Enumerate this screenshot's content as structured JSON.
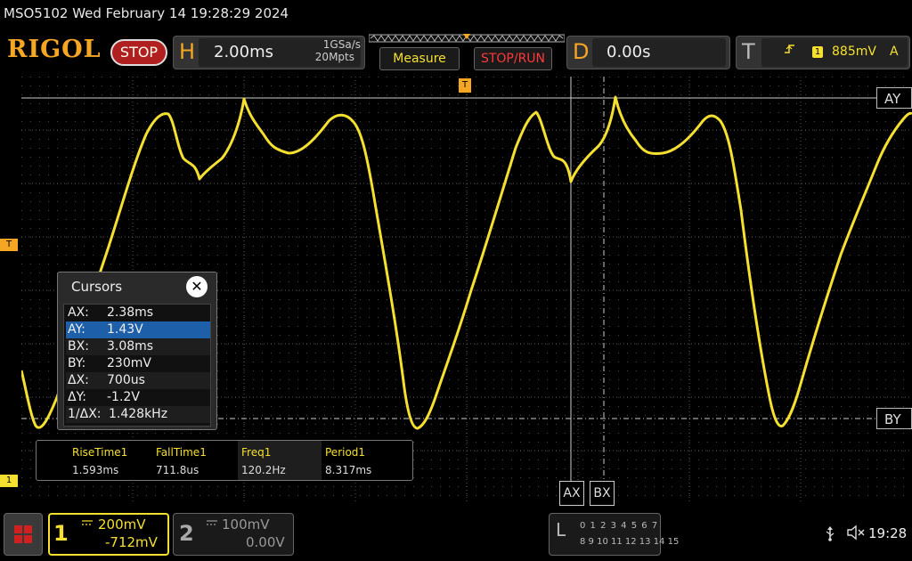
{
  "topbar": {
    "model_datetime": "MSO5102  Wed February 14 19:28:29 2024",
    "brand": "RIGOL",
    "run_state": "STOP",
    "horizontal": {
      "letter": "H",
      "timebase": "2.00ms",
      "sample_rate": "1GSa/s",
      "memory_depth": "20Mpts"
    },
    "measure_label": "Measure",
    "stoprun_label": "STOP/RUN",
    "delay": {
      "letter": "D",
      "value": "0.00s"
    },
    "trigger": {
      "letter": "T",
      "source": "1",
      "level": "885mV",
      "mode": "A"
    }
  },
  "markers": {
    "ay": "AY",
    "by": "BY",
    "ax": "AX",
    "bx": "BX",
    "trigger_level": "T",
    "trigger_top": "T",
    "ch1": "1"
  },
  "cursors": {
    "title": "Cursors",
    "close": "✕",
    "rows": [
      {
        "label": "AX:",
        "value": "2.38ms"
      },
      {
        "label": "AY:",
        "value": "1.43V"
      },
      {
        "label": "BX:",
        "value": "3.08ms"
      },
      {
        "label": "BY:",
        "value": "230mV"
      },
      {
        "label": "ΔX:",
        "value": "700us"
      },
      {
        "label": "ΔY:",
        "value": "-1.2V"
      },
      {
        "label": "1/ΔX:",
        "value": "1.428kHz"
      }
    ],
    "selected_row": 1
  },
  "measurements": [
    {
      "name": "RiseTime1",
      "value": "1.593ms"
    },
    {
      "name": "FallTime1",
      "value": "711.8us"
    },
    {
      "name": "Freq1",
      "value": "120.2Hz"
    },
    {
      "name": "Period1",
      "value": "8.317ms"
    }
  ],
  "channels": {
    "ch1": {
      "number": "1",
      "scale": "200mV",
      "offset": "-712mV",
      "coupling": "DC"
    },
    "ch2": {
      "number": "2",
      "scale": "100mV",
      "offset": "0.00V",
      "coupling": "DC"
    }
  },
  "logic": {
    "label": "L",
    "row1": "0 1 2 3  4 5 6 7",
    "row2": "8 9 10 11  12 13 14 15"
  },
  "status": {
    "usb_icon": "usb-icon",
    "speaker_icon": "speaker-muted-icon",
    "time": "19:28"
  },
  "colors": {
    "ch1": "#f5e030",
    "brand": "#f5a623",
    "stop": "#b02020",
    "selection": "#1e5faa"
  }
}
